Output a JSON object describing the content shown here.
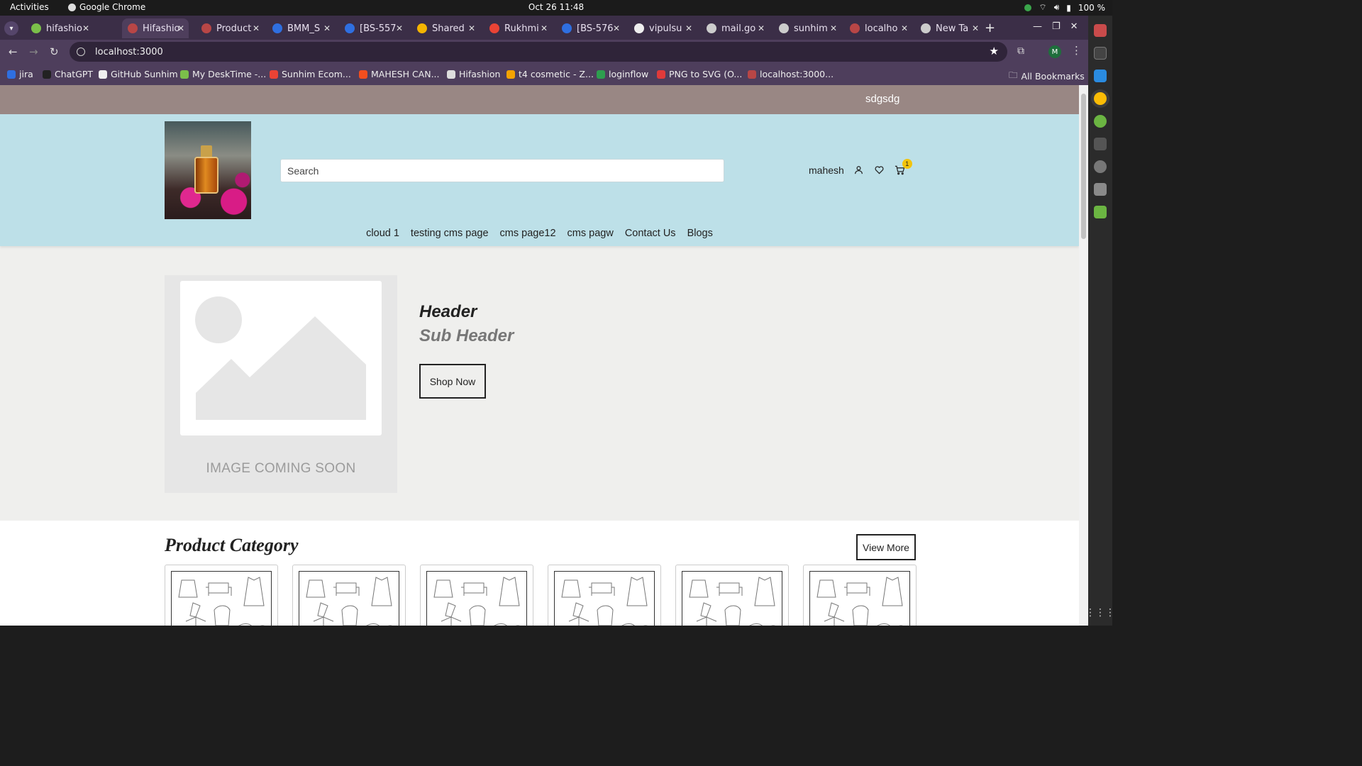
{
  "system": {
    "activities": "Activities",
    "app_name": "Google Chrome",
    "clock": "Oct 26  11:48",
    "battery": "100 %"
  },
  "tabs": [
    {
      "label": "hifashio",
      "fav_color": "#7bbf4a",
      "active": false
    },
    {
      "label": "Hifashio",
      "fav_color": "#b84646",
      "active": true
    },
    {
      "label": "Product",
      "fav_color": "#b84646",
      "active": false
    },
    {
      "label": "BMM_S",
      "fav_color": "#2f6fe0",
      "active": false
    },
    {
      "label": "[BS-557",
      "fav_color": "#2f6fe0",
      "active": false
    },
    {
      "label": "Shared",
      "fav_color": "#f4b400",
      "active": false
    },
    {
      "label": "Rukhmi",
      "fav_color": "#ea4335",
      "active": false
    },
    {
      "label": "[BS-576",
      "fav_color": "#2f6fe0",
      "active": false
    },
    {
      "label": "vipulsu",
      "fav_color": "#eeeeee",
      "active": false
    },
    {
      "label": "mail.go",
      "fav_color": "#cccccc",
      "active": false
    },
    {
      "label": "sunhim",
      "fav_color": "#cccccc",
      "active": false
    },
    {
      "label": "localho",
      "fav_color": "#b84646",
      "active": false
    },
    {
      "label": "New Ta",
      "fav_color": "#cccccc",
      "active": false
    }
  ],
  "address": {
    "url": "localhost:3000"
  },
  "profile_initial": "M",
  "bookmarks": [
    {
      "label": "jira",
      "color": "#2f6fe0"
    },
    {
      "label": "ChatGPT",
      "color": "#222222"
    },
    {
      "label": "GitHub Sunhim",
      "color": "#eeeeee"
    },
    {
      "label": "My DeskTime -...",
      "color": "#7bbf4a"
    },
    {
      "label": "Sunhim Ecom...",
      "color": "#ea4335"
    },
    {
      "label": "MAHESH CAN...",
      "color": "#f24e1e"
    },
    {
      "label": "Hifashion",
      "color": "#dddddd"
    },
    {
      "label": "t4 cosmetic - Z...",
      "color": "#f4a300"
    },
    {
      "label": "loginflow",
      "color": "#2e9e4f"
    },
    {
      "label": "PNG to SVG (O...",
      "color": "#e03a3a"
    },
    {
      "label": "localhost:3000...",
      "color": "#b84646"
    }
  ],
  "all_bookmarks": "All Bookmarks",
  "site": {
    "promo_text": "sdgsdg",
    "search_placeholder": "Search",
    "username": "mahesh",
    "cart_count": "1",
    "nav": [
      "cloud 1",
      "testing cms page",
      "cms page12",
      "cms pagw",
      "Contact Us",
      "Blogs"
    ],
    "hero": {
      "image_caption": "IMAGE COMING SOON",
      "title": "Header",
      "subtitle": "Sub Header",
      "cta": "Shop Now"
    },
    "category": {
      "title": "Product Category",
      "view_more": "View More",
      "card_count": 6
    }
  }
}
